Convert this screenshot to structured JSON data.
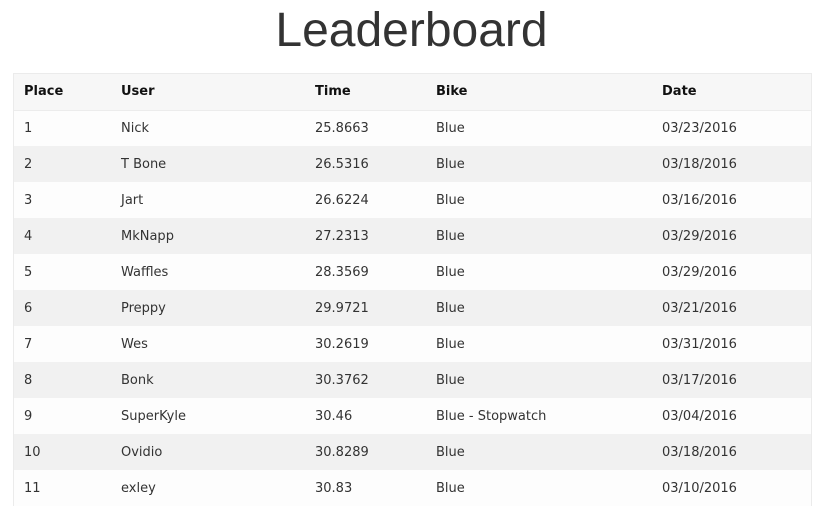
{
  "page": {
    "title": "Leaderboard"
  },
  "table": {
    "headers": {
      "place": "Place",
      "user": "User",
      "time": "Time",
      "bike": "Bike",
      "date": "Date"
    },
    "rows": [
      {
        "place": "1",
        "user": "Nick",
        "time": "25.8663",
        "bike": "Blue",
        "date": "03/23/2016"
      },
      {
        "place": "2",
        "user": "T Bone",
        "time": "26.5316",
        "bike": "Blue",
        "date": "03/18/2016"
      },
      {
        "place": "3",
        "user": "Jart",
        "time": "26.6224",
        "bike": "Blue",
        "date": "03/16/2016"
      },
      {
        "place": "4",
        "user": "MkNapp",
        "time": "27.2313",
        "bike": "Blue",
        "date": "03/29/2016"
      },
      {
        "place": "5",
        "user": "Waffles",
        "time": "28.3569",
        "bike": "Blue",
        "date": "03/29/2016"
      },
      {
        "place": "6",
        "user": "Preppy",
        "time": "29.9721",
        "bike": "Blue",
        "date": "03/21/2016"
      },
      {
        "place": "7",
        "user": "Wes",
        "time": "30.2619",
        "bike": "Blue",
        "date": "03/31/2016"
      },
      {
        "place": "8",
        "user": "Bonk",
        "time": "30.3762",
        "bike": "Blue",
        "date": "03/17/2016"
      },
      {
        "place": "9",
        "user": "SuperKyle",
        "time": "30.46",
        "bike": "Blue - Stopwatch",
        "date": "03/04/2016"
      },
      {
        "place": "10",
        "user": "Ovidio",
        "time": "30.8289",
        "bike": "Blue",
        "date": "03/18/2016"
      },
      {
        "place": "11",
        "user": "exley",
        "time": "30.83",
        "bike": "Blue",
        "date": "03/10/2016"
      }
    ]
  }
}
